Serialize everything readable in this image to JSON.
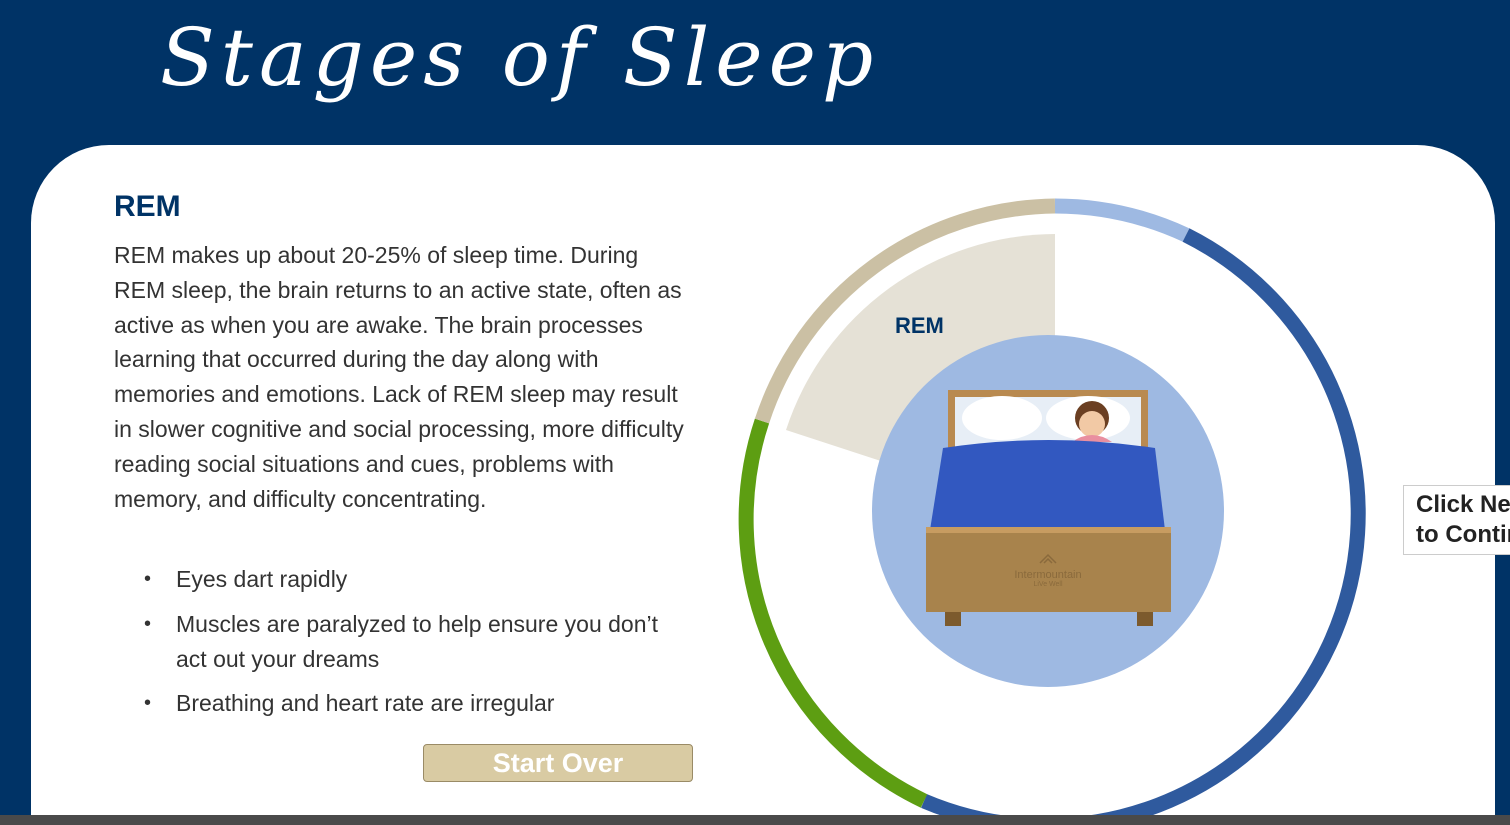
{
  "page": {
    "title": "Stages of Sleep"
  },
  "stage": {
    "heading": "REM",
    "description": "REM makes up about 20-25% of sleep time. During REM sleep, the brain returns to an active state, often as active as when you are awake. The brain processes learning that occurred during the day along with memories and emotions. Lack of REM sleep may result in slower cognitive and social processing, more difficulty reading social situations and cues, problems with memory, and difficulty concentrating.",
    "bullets": [
      "Eyes dart rapidly",
      "Muscles are paralyzed to help ensure you don’t act out your dreams",
      "Breathing and heart rate are irregular"
    ]
  },
  "controls": {
    "start_over_label": "Start Over",
    "next_label_line1": "Click Next",
    "next_label_line2": "to Continue"
  },
  "diagram": {
    "active_label": "REM",
    "bed_brand_line1": "Intermountain",
    "bed_brand_line2": "LiVe Well"
  },
  "colors": {
    "background": "#003366",
    "accent_blue": "#2f5a9e",
    "light_blue": "#9eb9e2",
    "green": "#5d9e12",
    "tan": "#cbc0a4",
    "wedge": "#e5e1d6",
    "button": "#d9cba3"
  }
}
